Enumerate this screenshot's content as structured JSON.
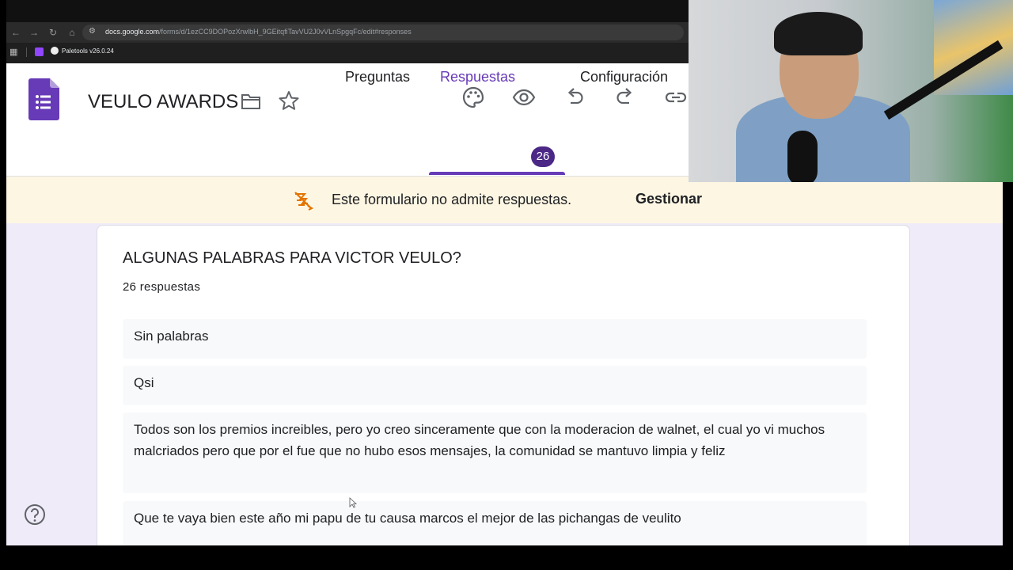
{
  "browser": {
    "url_host": "docs.google.com",
    "url_path": "/forms/d/1ezCC9DOPozXrwlbH_9GEitqfiTavVU2J0vVLnSpgqFc/edit#responses",
    "bookmark_label": "Paletools v26.0.24"
  },
  "form": {
    "title": "VEULO AWARDS",
    "tabs": [
      {
        "label": "Preguntas"
      },
      {
        "label": "Respuestas"
      },
      {
        "label": "Configuración"
      }
    ],
    "responses_count_badge": "26"
  },
  "banner": {
    "message": "Este formulario no admite respuestas.",
    "action_label": "Gestionar"
  },
  "question": {
    "title": "ALGUNAS PALABRAS PARA VICTOR VEULO?",
    "count_label": "26 respuestas",
    "responses": [
      "Sin palabras",
      "Qsi",
      "Todos son los premios increibles, pero yo creo sinceramente que con la moderacion de walnet, el cual yo vi muchos malcriados pero que por el fue que no hubo esos mensajes, la comunidad se mantuvo limpia y feliz",
      "Que te vaya bien este año mi papu de tu causa marcos el mejor de las pichangas de veulito"
    ]
  },
  "colors": {
    "accent": "#673ab7",
    "badge": "#4b2886",
    "banner_bg": "#fdf6e3",
    "page_bg": "#f0ebf8"
  }
}
